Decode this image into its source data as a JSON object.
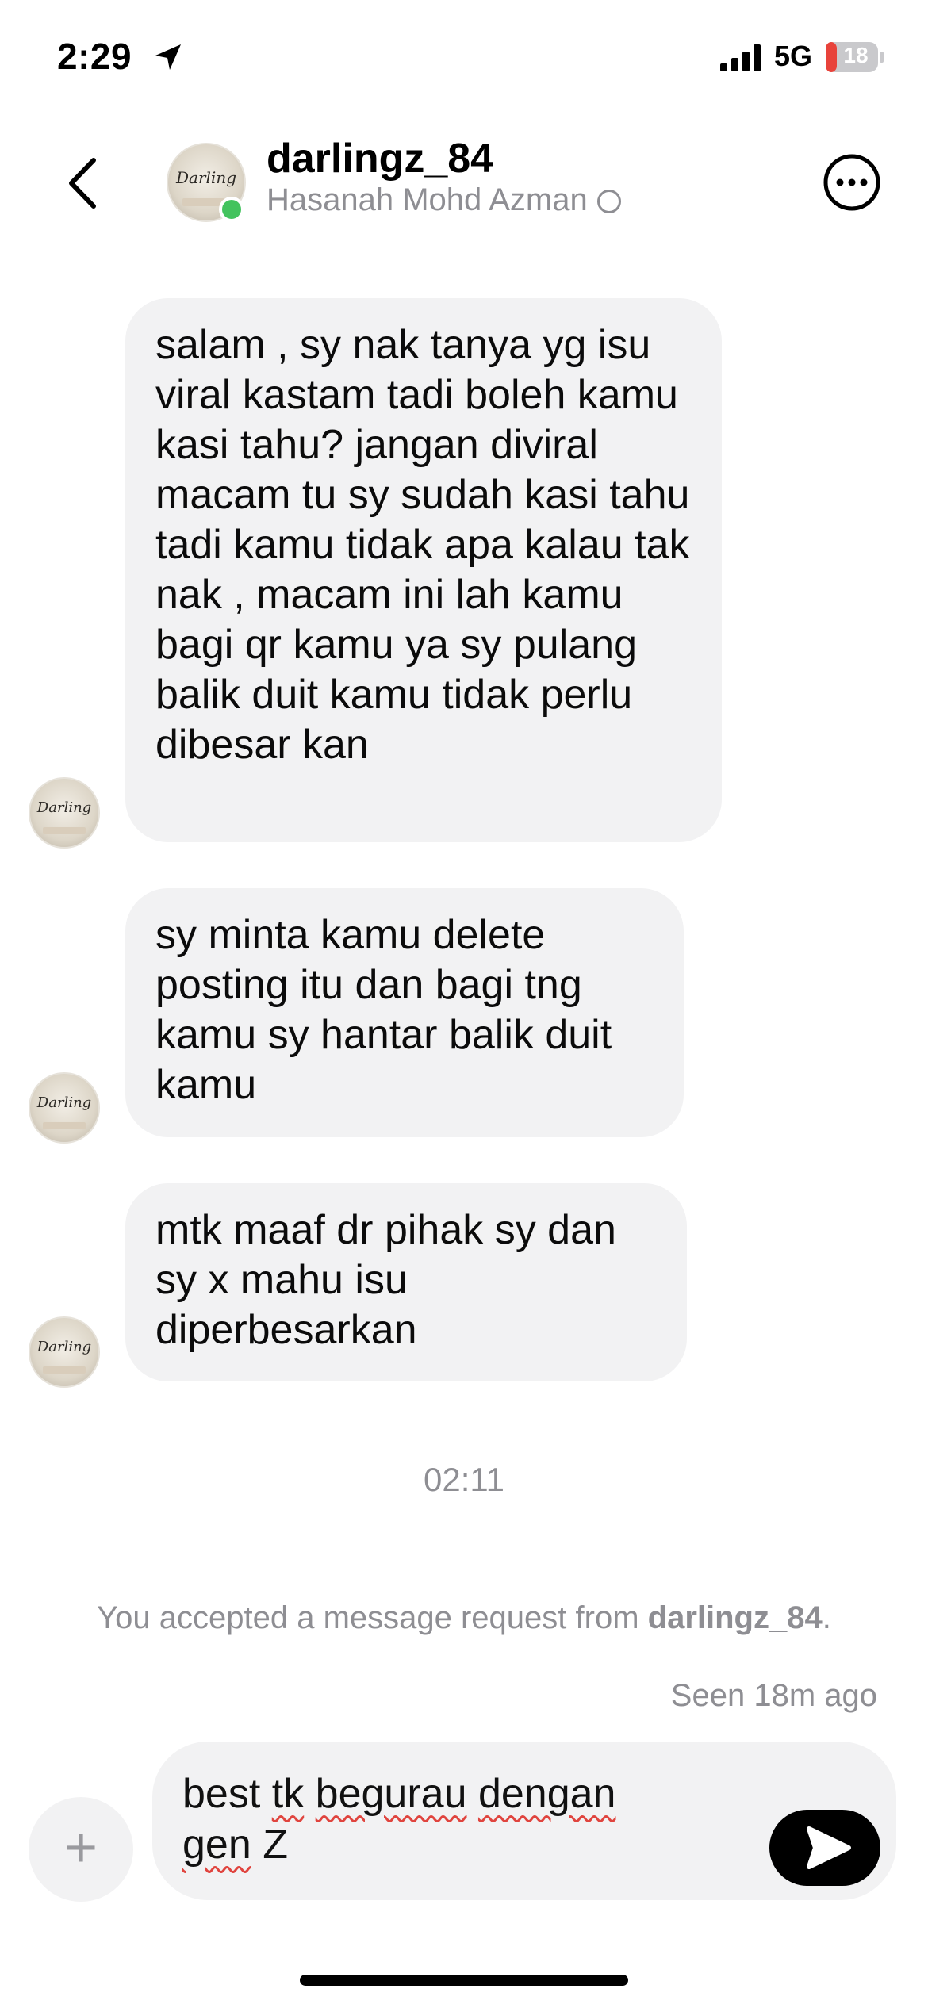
{
  "status_bar": {
    "time": "2:29",
    "network": "5G",
    "battery": "18"
  },
  "header": {
    "username": "darlingz_84",
    "real_name": "Hasanah Mohd Azman"
  },
  "messages": [
    {
      "sender": "darlingz_84",
      "text": "salam ,  sy nak tanya yg isu viral kastam tadi boleh kamu kasi tahu? jangan diviral macam tu sy sudah kasi tahu tadi kamu tidak apa kalau tak nak , macam ini lah kamu bagi qr kamu ya sy pulang balik duit kamu tidak perlu dibesar kan"
    },
    {
      "sender": "darlingz_84",
      "text": "sy minta kamu delete posting itu dan bagi tng kamu sy hantar balik duit kamu"
    },
    {
      "sender": "darlingz_84",
      "text": "mtk maaf dr pihak sy dan sy x mahu isu diperbesarkan"
    }
  ],
  "timestamp": "02:11",
  "notice": {
    "prefix": "You accepted a message request from ",
    "username": "darlingz_84",
    "suffix": "."
  },
  "seen_status": "Seen 18m ago",
  "composer": {
    "plus_label": "+",
    "draft_words": [
      "best",
      "tk",
      "begurau",
      "dengan",
      "gen",
      "Z"
    ],
    "misspelled": [
      false,
      true,
      true,
      true,
      true,
      false
    ]
  },
  "avatar_logo": "Darling",
  "icons": {
    "back": "chevron-left-icon",
    "more": "more-options-icon",
    "send": "send-icon",
    "location": "location-arrow-icon",
    "signal": "cellular-signal-icon",
    "battery": "battery-icon"
  },
  "colors": {
    "bubble": "#f2f2f3",
    "online": "#43c35e",
    "battery_low": "#e8433b",
    "spellcheck": "#e0443e",
    "muted_text": "#8e8e93"
  }
}
